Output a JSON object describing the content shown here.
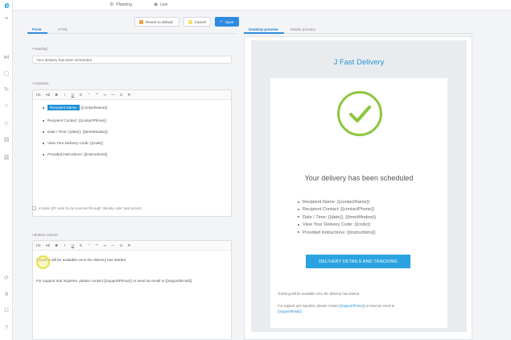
{
  "app": {
    "logo_letter": "e"
  },
  "topnav": [
    {
      "label": "Planning",
      "icon": "planning-icon"
    },
    {
      "label": "Live",
      "icon": "live-icon"
    }
  ],
  "actions": {
    "revert_label": "Revert to default",
    "cancel_label": "Cancel",
    "save_label": "Save"
  },
  "tabs_left": [
    {
      "label": "Form",
      "active": true
    },
    {
      "label": "HTML",
      "active": false
    }
  ],
  "tabs_right": [
    {
      "label": "Desktop preview",
      "active": true
    },
    {
      "label": "Mobile preview",
      "active": false
    }
  ],
  "form": {
    "heading_label": "Heading:",
    "heading_value": "Your delivery has been scheduled",
    "contents_label": "Contents:",
    "toolbar": [
      "H1",
      "H2",
      "B",
      "I",
      "U",
      "S",
      "\"",
      "\"\"",
      "∞",
      "—",
      "U",
      "R"
    ],
    "contents_lines": [
      {
        "highlight": "Recipient Name:",
        "rest": " {{contactName}}"
      },
      {
        "highlight": "",
        "rest": "Recipient Contact: {{contactPhone}}"
      },
      {
        "highlight": "",
        "rest": "Date / Time: {{date}}, {{timeWindow}}"
      },
      {
        "highlight": "",
        "rest": "View Your Delivery Code: {{code}}"
      },
      {
        "highlight": "",
        "rest": "Provided instructions: {{instructions}}"
      }
    ],
    "qr_label": "Include QR code (to be scanned through 'Identity code' task action)",
    "bottom_label": "Bottom content:",
    "bottom_line1": "Tracking will be available once the delivery has started.",
    "bottom_line2": "For support and inquiries, please contact {{supportPhone}} or send an email to {{supportEmail}}"
  },
  "preview": {
    "company": "J Fast Delivery",
    "heading": "Your delivery has been scheduled",
    "list": [
      "Recipient Name: {{contactName}}",
      "Recipient Contact: {{contactPhone}}",
      "Date / Time: {{date}}, {{timeWindow}}",
      "View Your Delivery Code: {{code}}",
      "Provided instructions: {{instructions}}"
    ],
    "button_label": "DELIVERY DETAILS AND TRACKING",
    "tracking_note": "Tracking will be available once the delivery has started.",
    "support_prefix": "For support and inquiries, please contact ",
    "support_phone": "{{supportPhone}}",
    "support_mid": " or send an email to",
    "support_email": "{{supportEmail}}"
  },
  "colors": {
    "accent": "#2f8be0",
    "check": "#8dc63f",
    "title": "#2a92d4",
    "highlight": "#e6e04a"
  }
}
